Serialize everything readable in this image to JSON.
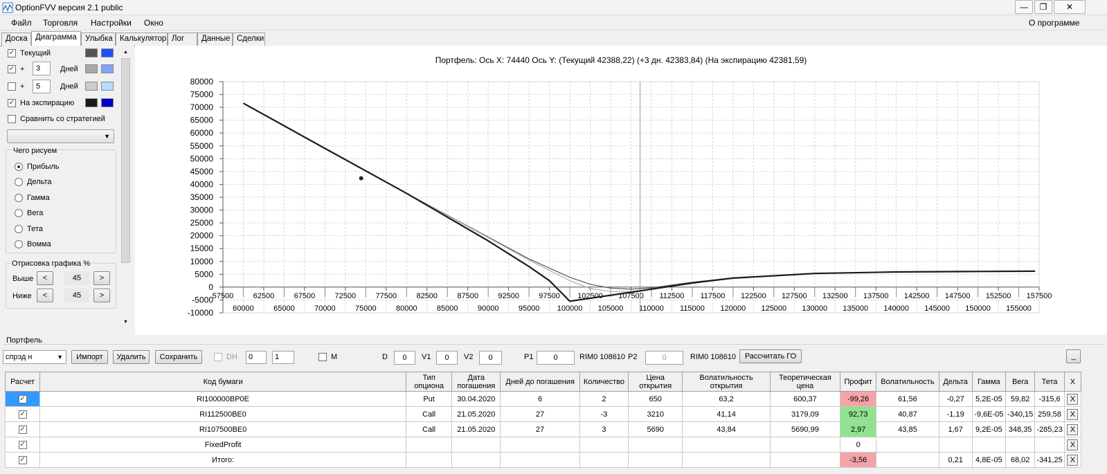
{
  "window": {
    "title": "OptionFVV версия 2.1 public",
    "minimize": "—",
    "restore": "❐",
    "close": "✕"
  },
  "menu": {
    "items": [
      "Файл",
      "Торговля",
      "Настройки",
      "Окно"
    ],
    "about": "О программе"
  },
  "tabs": [
    "Доска",
    "Диаграмма",
    "Улыбка",
    "Калькулятор",
    "Лог",
    "Данные",
    "Сделки"
  ],
  "left": {
    "current": {
      "label": "Текущий",
      "checked": true,
      "color1": "#555555",
      "color2": "#1f4fff"
    },
    "plus1": {
      "sign": "+",
      "value": "3",
      "unit": "Дней",
      "checked": true,
      "color1": "#a8a8a8",
      "color2": "#7fa6ff"
    },
    "plus2": {
      "sign": "+",
      "value": "5",
      "unit": "Дней",
      "checked": false,
      "color1": "#cccccc",
      "color2": "#b8dcff"
    },
    "expiry": {
      "label": "На экспирацию",
      "checked": true,
      "color1": "#1a1a1a",
      "color2": "#0000c8"
    },
    "compare": {
      "label": "Сравнить со стратегией",
      "checked": false
    },
    "draw_group": {
      "title": "Чего рисуем",
      "options": [
        "Прибыль",
        "Дельта",
        "Гамма",
        "Вега",
        "Тета",
        "Вомма"
      ],
      "selected": 0
    },
    "render_group": {
      "title": "Отрисовка графика %",
      "above_label": "Выше",
      "above_value": "45",
      "below_label": "Ниже",
      "below_value": "45",
      "dec": "<",
      "inc": ">"
    }
  },
  "chart": {
    "header": "Портфель: Ось X: 74440 Ось Y:  (Текущий 42388,22)  (+3 дн. 42383,84)  (На экспирацию 42381,59)",
    "y_ticks": [
      "80000",
      "75000",
      "70000",
      "65000",
      "60000",
      "55000",
      "50000",
      "45000",
      "40000",
      "35000",
      "30000",
      "25000",
      "20000",
      "15000",
      "10000",
      "5000",
      "0",
      "-5000",
      "-10000"
    ],
    "x_ticks_top": [
      "57500",
      "62500",
      "67500",
      "72500",
      "77500",
      "82500",
      "87500",
      "92500",
      "97500",
      "102500",
      "107500",
      "112500",
      "117500",
      "122500",
      "127500",
      "132500",
      "137500",
      "142500",
      "147500",
      "152500",
      "157500"
    ],
    "x_ticks_bottom": [
      "60000",
      "65000",
      "70000",
      "75000",
      "80000",
      "85000",
      "90000",
      "95000",
      "100000",
      "105000",
      "110000",
      "115000",
      "120000",
      "125000",
      "130000",
      "135000",
      "140000",
      "145000",
      "150000",
      "155000"
    ]
  },
  "chart_data": {
    "type": "line",
    "xlim": [
      57500,
      157500
    ],
    "ylim": [
      -10000,
      80000
    ],
    "cursor_x": 108610,
    "marker": {
      "x": 74440,
      "y": 42388
    },
    "series": [
      {
        "name": "Текущий",
        "x": [
          60000,
          70000,
          80000,
          90000,
          95000,
          100000,
          102500,
          105000,
          107500,
          110000,
          115000,
          120000,
          130000,
          140000,
          150000,
          157000
        ],
        "y": [
          71600,
          54000,
          36500,
          19500,
          11000,
          3800,
          1100,
          -400,
          -800,
          -300,
          1900,
          3600,
          5400,
          5900,
          6100,
          6200
        ]
      },
      {
        "name": "+3 дн.",
        "x": [
          60000,
          70000,
          80000,
          90000,
          95000,
          100000,
          102500,
          105000,
          107500,
          110000,
          115000,
          120000,
          130000,
          140000,
          150000,
          157000
        ],
        "y": [
          71600,
          54000,
          36500,
          19300,
          10500,
          2500,
          -600,
          -1700,
          -1700,
          -900,
          1500,
          3400,
          5300,
          5900,
          6100,
          6200
        ]
      },
      {
        "name": "На экспирацию",
        "x": [
          60000,
          70000,
          80000,
          90000,
          95000,
          97500,
          100000,
          107500,
          115000,
          120000,
          130000,
          140000,
          150000,
          157000
        ],
        "y": [
          71600,
          54000,
          36500,
          18000,
          8000,
          2500,
          -5500,
          -2000,
          1600,
          3500,
          5300,
          5900,
          6100,
          6200
        ]
      }
    ]
  },
  "portfolio": {
    "section": "Портфель",
    "selector": "спрэд н",
    "import": "Импорт",
    "delete": "Удалить",
    "save": "Сохранить",
    "dh_label": "DH",
    "dh_val1": "0",
    "dh_val2": "1",
    "m_label": "M",
    "d_label": "D",
    "d_val": "0",
    "v1_label": "V1",
    "v1_val": "0",
    "v2_label": "V2",
    "v2_val": "0",
    "p1_label": "P1",
    "p1_val": "0",
    "rim1": "RIM0 108610",
    "p2_label": "P2",
    "p2_val": "0",
    "rim2": "RIM0 108610",
    "calc_go": "Рассчитать ГО",
    "collapse": "_"
  },
  "table": {
    "headers": [
      "Расчет",
      "Код бумаги",
      "Тип опциона",
      "Дата погашения",
      "Дней до погашения",
      "Количество",
      "Цена открытия",
      "Волатильность открытия",
      "Теоретическая цена",
      "Профит",
      "Волатильность",
      "Дельта",
      "Гамма",
      "Вега",
      "Тета",
      "X"
    ],
    "rows": [
      [
        "✓",
        "RI100000BP0E",
        "Put",
        "30.04.2020",
        "6",
        "2",
        "650",
        "63,2",
        "600,37",
        "-99,26",
        "61,56",
        "-0,27",
        "5,2E-05",
        "59,82",
        "-315,6",
        "X"
      ],
      [
        "✓",
        "RI112500BE0",
        "Call",
        "21.05.2020",
        "27",
        "-3",
        "3210",
        "41,14",
        "3179,09",
        "92,73",
        "40,87",
        "-1,19",
        "-9,6E-05",
        "-340,15",
        "259,58",
        "X"
      ],
      [
        "✓",
        "RI107500BE0",
        "Call",
        "21.05.2020",
        "27",
        "3",
        "5690",
        "43,84",
        "5690,99",
        "2,97",
        "43,85",
        "1,67",
        "9,2E-05",
        "348,35",
        "-285,23",
        "X"
      ],
      [
        "✓",
        "FixedProfit",
        "",
        "",
        "",
        "",
        "",
        "",
        "",
        "0",
        "",
        "",
        "",
        "",
        "",
        "X"
      ],
      [
        "✓",
        "Итого:",
        "",
        "",
        "",
        "",
        "",
        "",
        "",
        "-3,56",
        "",
        "0,21",
        "4,8E-05",
        "68,02",
        "-341,25",
        "X"
      ]
    ],
    "profit_colors": [
      "red",
      "green",
      "green",
      "none",
      "red"
    ]
  }
}
